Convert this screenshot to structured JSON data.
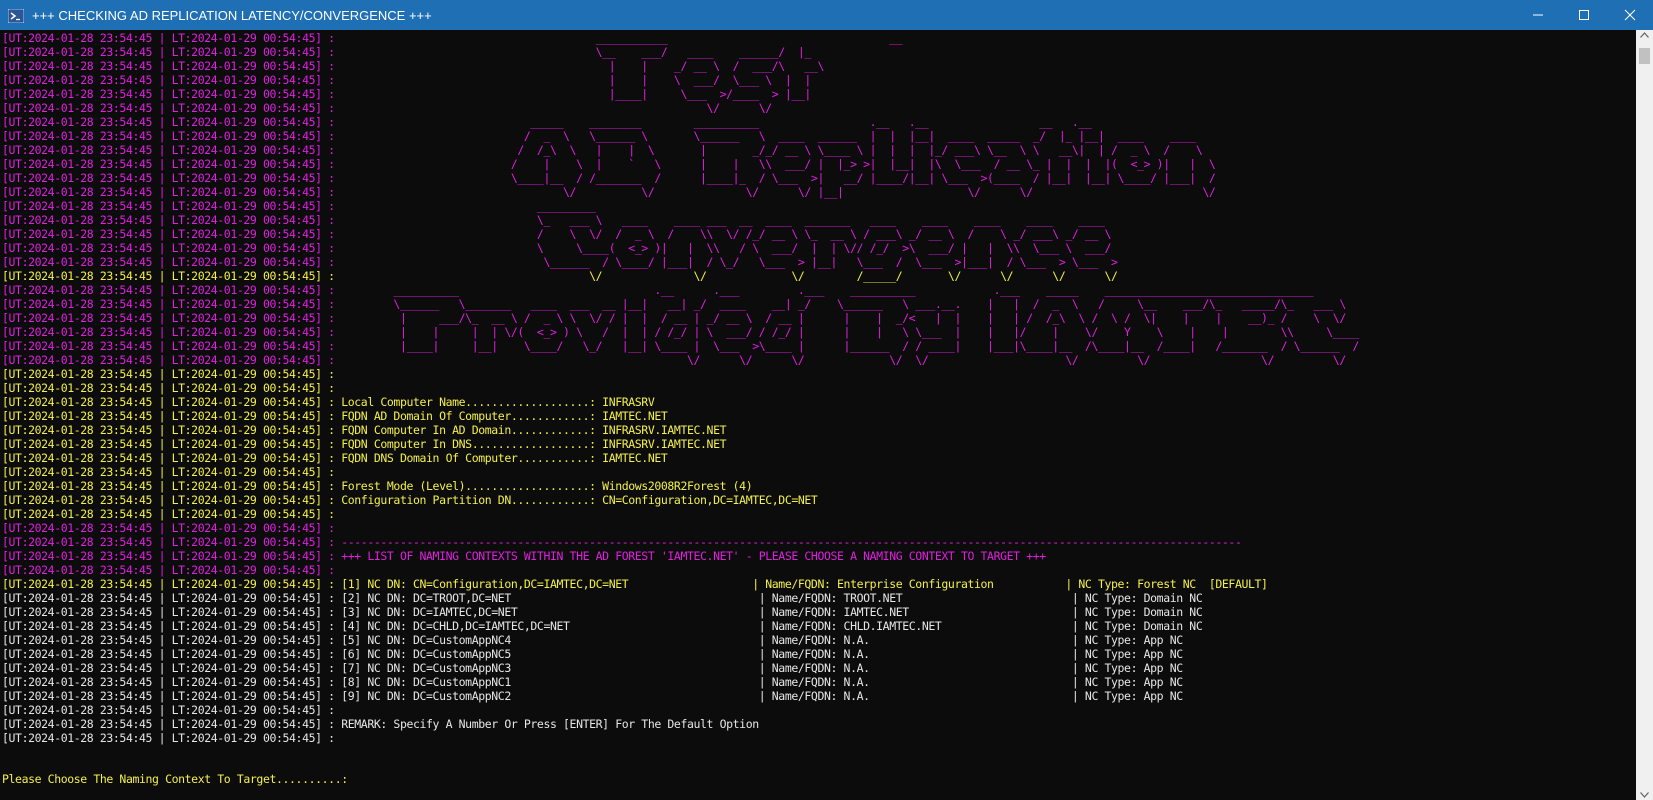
{
  "window": {
    "title": "+++ CHECKING AD REPLICATION LATENCY/CONVERGENCE +++",
    "minimize_label": "Minimize",
    "maximize_label": "Maximize",
    "close_label": "Close"
  },
  "colors": {
    "magenta": "#e01fe0",
    "yellow": "#f4f04a",
    "white": "#e6e6e6",
    "titlebar": "#1f6fb4",
    "background": "#0c0c0c"
  },
  "console": {
    "lines": [
      {
        "c": "m",
        "t": "[UT:2024-01-28 23:54:45 | LT:2024-01-29 00:54:45] :                                        ___________                                  __"
      },
      {
        "c": "m",
        "t": "[UT:2024-01-28 23:54:45 | LT:2024-01-29 00:54:45] :                                        \\__    ___/   ____    ______/  |_"
      },
      {
        "c": "m",
        "t": "[UT:2024-01-28 23:54:45 | LT:2024-01-29 00:54:45] :                                          |    |    _/ __ \\  /  ___/\\   __\\"
      },
      {
        "c": "m",
        "t": "[UT:2024-01-28 23:54:45 | LT:2024-01-29 00:54:45] :                                          |    |    \\  ___/  \\___ \\  |  |"
      },
      {
        "c": "m",
        "t": "[UT:2024-01-28 23:54:45 | LT:2024-01-29 00:54:45] :                                          |____|     \\___  >/____  > |__|"
      },
      {
        "c": "m",
        "t": "[UT:2024-01-28 23:54:45 | LT:2024-01-29 00:54:45] :                                                         \\/      \\/"
      },
      {
        "c": "m",
        "t": "[UT:2024-01-28 23:54:45 | LT:2024-01-29 00:54:45] :                              _____    ________        __________                 .__   .__                 __   .__"
      },
      {
        "c": "m",
        "t": "[UT:2024-01-28 23:54:45 | LT:2024-01-29 00:54:45] :                             /  _  \\   \\______ \\       \\______   \\  ____  ______  |  |  |__|  ____  _____  _/  |_ |__|  ____    ____"
      },
      {
        "c": "m",
        "t": "[UT:2024-01-28 23:54:45 | LT:2024-01-29 00:54:45] :                            /  /_\\  \\   |    |  \\       |       _/_/ __ \\ \\____ \\ |  |  |  |_/ ___\\ \\__  \\ \\   __\\|  | /  _ \\  /    \\"
      },
      {
        "c": "m",
        "t": "[UT:2024-01-28 23:54:45 | LT:2024-01-29 00:54:45] :                           /    |    \\  |    `   \\      |    |   \\\\  ___/ |  |_> >|  |__|  |\\  \\___  / __ \\_ |  |  |  |(  <_> )|   |  \\"
      },
      {
        "c": "m",
        "t": "[UT:2024-01-28 23:54:45 | LT:2024-01-29 00:54:45] :                           \\____|__  / /_______  /      |____|_  / \\___  >|   __/ |____/|__| \\___  >(____  / |__|  |__| \\____/ |___|  /"
      },
      {
        "c": "m",
        "t": "[UT:2024-01-28 23:54:45 | LT:2024-01-29 00:54:45] :                                   \\/          \\/              \\/      \\/ |__|                   \\/      \\/                          \\/"
      },
      {
        "c": "m",
        "t": "[UT:2024-01-28 23:54:45 | LT:2024-01-29 00:54:45] :                               _________"
      },
      {
        "c": "m",
        "t": "[UT:2024-01-28 23:54:45 | LT:2024-01-29 00:54:45] :                               \\_   ___ \\   ____    ____ ___  __  ____  _______   ____    ____    ____    ____    ____"
      },
      {
        "c": "m",
        "t": "[UT:2024-01-28 23:54:45 | LT:2024-01-29 00:54:45] :                               /    \\  \\/  /  _ \\  /    \\\\  \\/ /_/ __ \\ \\_  __ \\ / ___\\ _/ __ \\  /    \\ _/ ___\\ _/ __ \\"
      },
      {
        "c": "m",
        "t": "[UT:2024-01-28 23:54:45 | LT:2024-01-29 00:54:45] :                               \\     \\____(  <_> )|   |  \\\\   / \\  ___/  |  | \\// /_/  >\\  ___/ |   |  \\\\  \\___ \\  ___/"
      },
      {
        "c": "m",
        "t": "[UT:2024-01-28 23:54:45 | LT:2024-01-29 00:54:45] :                                \\______  / \\____/ |___|  / \\_/   \\___  > |__|   \\___  /  \\___  >|___|  / \\___  > \\___  >"
      },
      {
        "c": "y",
        "t": "[UT:2024-01-28 23:54:45 | LT:2024-01-29 00:54:45] :                                       \\/              \\/             \\/        /_____/       \\/      \\/      \\/      \\/"
      },
      {
        "c": "m",
        "t": "[UT:2024-01-28 23:54:45 | LT:2024-01-29 00:54:45] :         __________                              .__      .___         .___    __________            .___    _____    ________________________________"
      },
      {
        "c": "m",
        "t": "[UT:2024-01-28 23:54:45 | LT:2024-01-29 00:54:45] :         \\______   \\_______   ____  ___  __ |__|   __| _/  ____    __| _/    \\______   \\ ___.__.    |   |  /  _  \\   /     \\__    ___/\\_   _____/\\_   ___ \\"
      },
      {
        "c": "m",
        "t": "[UT:2024-01-28 23:54:45 | LT:2024-01-29 00:54:45] :          |     ___/\\_  __ \\ /  _ \\ \\  \\/ / |  |  / __ | _/ __ \\  / __ |      |    |  _/<   |  |    |   | /  /_\\  \\ /  \\ /  \\|    |    |    __)_ /    \\  \\/"
      },
      {
        "c": "m",
        "t": "[UT:2024-01-28 23:54:45 | LT:2024-01-29 00:54:45] :          |    |     |  | \\/(  <_> ) \\   /  |  | / /_/ | \\  ___/ / /_/ |      |    |   \\ \\___  |    |   |/    |    \\/    Y    \\    |    |        \\\\     \\____"
      },
      {
        "c": "m",
        "t": "[UT:2024-01-28 23:54:45 | LT:2024-01-29 00:54:45] :          |____|     |__|    \\____/   \\_/   |__| \\____ |  \\___  >\\____ |      |______  / / ____|    |___|\\____|__  /\\____|__  /____|   /_______  / \\______  /"
      },
      {
        "c": "m",
        "t": "[UT:2024-01-28 23:54:45 | LT:2024-01-29 00:54:45] :                                                      \\/      \\/      \\/             \\/  \\/                     \\/         \\/                 \\/         \\/"
      },
      {
        "c": "y",
        "t": "[UT:2024-01-28 23:54:45 | LT:2024-01-29 00:54:45] :"
      },
      {
        "c": "y",
        "t": "[UT:2024-01-28 23:54:45 | LT:2024-01-29 00:54:45] :"
      },
      {
        "c": "y",
        "t": "[UT:2024-01-28 23:54:45 | LT:2024-01-29 00:54:45] : Local Computer Name...................: INFRASRV"
      },
      {
        "c": "y",
        "t": "[UT:2024-01-28 23:54:45 | LT:2024-01-29 00:54:45] : FQDN AD Domain Of Computer............: IAMTEC.NET"
      },
      {
        "c": "y",
        "t": "[UT:2024-01-28 23:54:45 | LT:2024-01-29 00:54:45] : FQDN Computer In AD Domain............: INFRASRV.IAMTEC.NET"
      },
      {
        "c": "y",
        "t": "[UT:2024-01-28 23:54:45 | LT:2024-01-29 00:54:45] : FQDN Computer In DNS..................: INFRASRV.IAMTEC.NET"
      },
      {
        "c": "y",
        "t": "[UT:2024-01-28 23:54:45 | LT:2024-01-29 00:54:45] : FQDN DNS Domain Of Computer...........: IAMTEC.NET"
      },
      {
        "c": "y",
        "t": "[UT:2024-01-28 23:54:45 | LT:2024-01-29 00:54:45] :"
      },
      {
        "c": "y",
        "t": "[UT:2024-01-28 23:54:45 | LT:2024-01-29 00:54:45] : Forest Mode (Level)...................: Windows2008R2Forest (4)"
      },
      {
        "c": "y",
        "t": "[UT:2024-01-28 23:54:45 | LT:2024-01-29 00:54:45] : Configuration Partition DN............: CN=Configuration,DC=IAMTEC,DC=NET"
      },
      {
        "c": "y",
        "t": "[UT:2024-01-28 23:54:45 | LT:2024-01-29 00:54:45] :"
      },
      {
        "c": "m",
        "t": "[UT:2024-01-28 23:54:45 | LT:2024-01-29 00:54:45] :"
      },
      {
        "c": "m",
        "t": "[UT:2024-01-28 23:54:45 | LT:2024-01-29 00:54:45] : ------------------------------------------------------------------------------------------------------------------------------------------"
      },
      {
        "c": "m",
        "t": "[UT:2024-01-28 23:54:45 | LT:2024-01-29 00:54:45] : +++ LIST OF NAMING CONTEXTS WITHIN THE AD FOREST 'IAMTEC.NET' - PLEASE CHOOSE A NAMING CONTEXT TO TARGET +++"
      },
      {
        "c": "m",
        "t": "[UT:2024-01-28 23:54:45 | LT:2024-01-29 00:54:45] :"
      },
      {
        "c": "y",
        "t": "[UT:2024-01-28 23:54:45 | LT:2024-01-29 00:54:45] : [1] NC DN: CN=Configuration,DC=IAMTEC,DC=NET                   | Name/FQDN: Enterprise Configuration           | NC Type: Forest NC  [DEFAULT]"
      },
      {
        "c": "w",
        "t": "[UT:2024-01-28 23:54:45 | LT:2024-01-29 00:54:45] : [2] NC DN: DC=TROOT,DC=NET                                      | Name/FQDN: TROOT.NET                          | NC Type: Domain NC"
      },
      {
        "c": "w",
        "t": "[UT:2024-01-28 23:54:45 | LT:2024-01-29 00:54:45] : [3] NC DN: DC=IAMTEC,DC=NET                                     | Name/FQDN: IAMTEC.NET                         | NC Type: Domain NC"
      },
      {
        "c": "w",
        "t": "[UT:2024-01-28 23:54:45 | LT:2024-01-29 00:54:45] : [4] NC DN: DC=CHLD,DC=IAMTEC,DC=NET                             | Name/FQDN: CHLD.IAMTEC.NET                    | NC Type: Domain NC"
      },
      {
        "c": "w",
        "t": "[UT:2024-01-28 23:54:45 | LT:2024-01-29 00:54:45] : [5] NC DN: DC=CustomAppNC4                                      | Name/FQDN: N.A.                               | NC Type: App NC"
      },
      {
        "c": "w",
        "t": "[UT:2024-01-28 23:54:45 | LT:2024-01-29 00:54:45] : [6] NC DN: DC=CustomAppNC5                                      | Name/FQDN: N.A.                               | NC Type: App NC"
      },
      {
        "c": "w",
        "t": "[UT:2024-01-28 23:54:45 | LT:2024-01-29 00:54:45] : [7] NC DN: DC=CustomAppNC3                                      | Name/FQDN: N.A.                               | NC Type: App NC"
      },
      {
        "c": "w",
        "t": "[UT:2024-01-28 23:54:45 | LT:2024-01-29 00:54:45] : [8] NC DN: DC=CustomAppNC1                                      | Name/FQDN: N.A.                               | NC Type: App NC"
      },
      {
        "c": "w",
        "t": "[UT:2024-01-28 23:54:45 | LT:2024-01-29 00:54:45] : [9] NC DN: DC=CustomAppNC2                                      | Name/FQDN: N.A.                               | NC Type: App NC"
      },
      {
        "c": "w",
        "t": "[UT:2024-01-28 23:54:45 | LT:2024-01-29 00:54:45] :"
      },
      {
        "c": "w",
        "t": "[UT:2024-01-28 23:54:45 | LT:2024-01-29 00:54:45] : REMARK: Specify A Number Or Press [ENTER] For The Default Option"
      },
      {
        "c": "w",
        "t": "[UT:2024-01-28 23:54:45 | LT:2024-01-29 00:54:45] :"
      }
    ],
    "prompt": "Please Choose The Naming Context To Target..........:"
  }
}
